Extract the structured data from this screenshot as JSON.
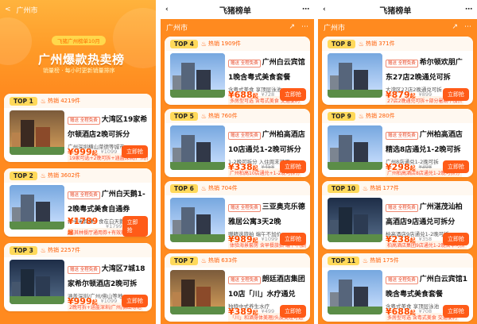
{
  "panel1": {
    "nav_back": "<",
    "city": "广州市",
    "hero": {
      "badge": "飞猪广州榜单10月",
      "title": "广州爆款热卖榜",
      "sub": "销量榜 · 每小时更新销量排序"
    },
    "items": [
      {
        "rank": "TOP 1",
        "hot": "热销 4219件",
        "tag1": "赠送 全程免费",
        "name": "大湾区19家希尔顿酒店2晚可拆分",
        "desc": "广州深圳横山菜德等城市",
        "promo": "19家可选+2晚可拆+涵盖深圳/广州/佛山",
        "price": "999",
        "price_suffix": "起",
        "old": "¥1099",
        "btn": "立即抢"
      },
      {
        "rank": "TOP 2",
        "hot": "热销 3602件",
        "tag1": "赠送 全程免费",
        "name": "广州白天鹅1-2晚粤式美食自通券",
        "desc": "打卡米其林，食在白天鹅",
        "promo": "米其林餐厅通用券+有效期长+过期退",
        "price": "1789",
        "price_suffix": "起",
        "old": "¥1799",
        "btn": "立即抢"
      },
      {
        "rank": "TOP 3",
        "hot": "热销 2257件",
        "tag1": "赠送 全程免费",
        "name": "大湾区7城18家希尔顿酒店2晚可拆",
        "desc": "涵盖深圳/广州/佛山等地",
        "promo": "2晚可拆+涵盖深圳/广州/佛山等地",
        "price": "999",
        "price_suffix": "起",
        "old": "¥1099",
        "btn": "立即抢"
      }
    ]
  },
  "panel2": {
    "title": "飞猪榜单",
    "city": "广州市",
    "items": [
      {
        "rank": "TOP 4",
        "hot": "热销 1909件",
        "tag1": "赠送 全程免费",
        "name": "广州白云宾馆1晚含粤式美食套餐",
        "desc": "含粤式美食 享顶层泳池",
        "promo": "多房型可选 含粤式美食 交通便利",
        "price": "688",
        "price_suffix": "起",
        "old": "¥728",
        "btn": "立即抢"
      },
      {
        "rank": "TOP 5",
        "hot": "热销 760件",
        "tag1": "赠送 全程免费",
        "name": "广州柏高酒店10店通兑1-2晚可拆分",
        "desc": "1-2晚可拆分 入住周末可用",
        "promo": "广州柏高10店通兑+1-2晚可拆分",
        "price": "338",
        "price_suffix": "起",
        "old": "¥458",
        "btn": "立即抢"
      },
      {
        "rank": "TOP 6",
        "hot": "热销 704件",
        "tag1": "赠送 全程免费",
        "name": "三亚奥克乐德雅居公寓3天2晚",
        "desc": "赠精选旅拍 端午不加价",
        "promo": "体验海景套房 含早餐旅拍 端午不加价",
        "price": "989",
        "price_suffix": "起",
        "old": "¥1099",
        "btn": "立即抢"
      },
      {
        "rank": "TOP 7",
        "hot": "热销 633件",
        "tag1": "赠送 全程免费",
        "name": "朗廷酒店集团10店「川」水疗通兑",
        "desc": "独特中式养生水疗",
        "promo": "「川」和酒身体美理/头皮美理可选",
        "price": "389",
        "price_suffix": "起",
        "old": "¥499",
        "btn": "立即抢"
      }
    ]
  },
  "panel3": {
    "title": "飞猪榜单",
    "city": "广州市",
    "items": [
      {
        "rank": "TOP 8",
        "hot": "热销 371件",
        "tag1": "赠送 全程免费",
        "name": "希尔顿欢朋广东27店2晚通兑可拆",
        "desc": "大湾区27店2晚通兑可拆",
        "promo": "27店2晚通兑可拆+部分暑期不加价",
        "price": "879",
        "price_suffix": "起",
        "old": "¥899",
        "btn": "立即抢"
      },
      {
        "rank": "TOP 9",
        "hot": "热销 280件",
        "tag1": "赠送 全程免费",
        "name": "广州柏高酒店精选8店通兑1-2晚可拆",
        "desc": "广州8店通兑1-2晚可拆",
        "promo": "广州柏高酒店8店通兑1-2晚可拆分",
        "price": "298",
        "price_suffix": "起",
        "old": "¥398",
        "btn": "立即抢"
      },
      {
        "rank": "TOP 10",
        "hot": "热销 177件",
        "tag1": "赠送 全程免费",
        "name": "广州湛茂汕柏高酒店9店通兑可拆分",
        "desc": "柏高酒店9店通兑1-2晚可拆",
        "promo": "柏高酒店集团9店通兑1-2晚含早可拆",
        "price": "238",
        "price_suffix": "起",
        "old": "¥358",
        "btn": "立即抢"
      },
      {
        "rank": "TOP 11",
        "hot": "热销 175件",
        "tag1": "赠送 全程免费",
        "name": "广州白云宾馆1晚含粤式美食套餐",
        "desc": "含粤式美食 享顶层泳池",
        "promo": "多房型可选 含粤式美食 交通便利",
        "price": "688",
        "price_suffix": "起",
        "old": "¥708",
        "btn": "立即抢"
      }
    ]
  },
  "colors": {
    "accent": "#ff8a1f",
    "button": "#ff5b18",
    "price": "#ff4d00",
    "hot": "#ff5c00"
  }
}
